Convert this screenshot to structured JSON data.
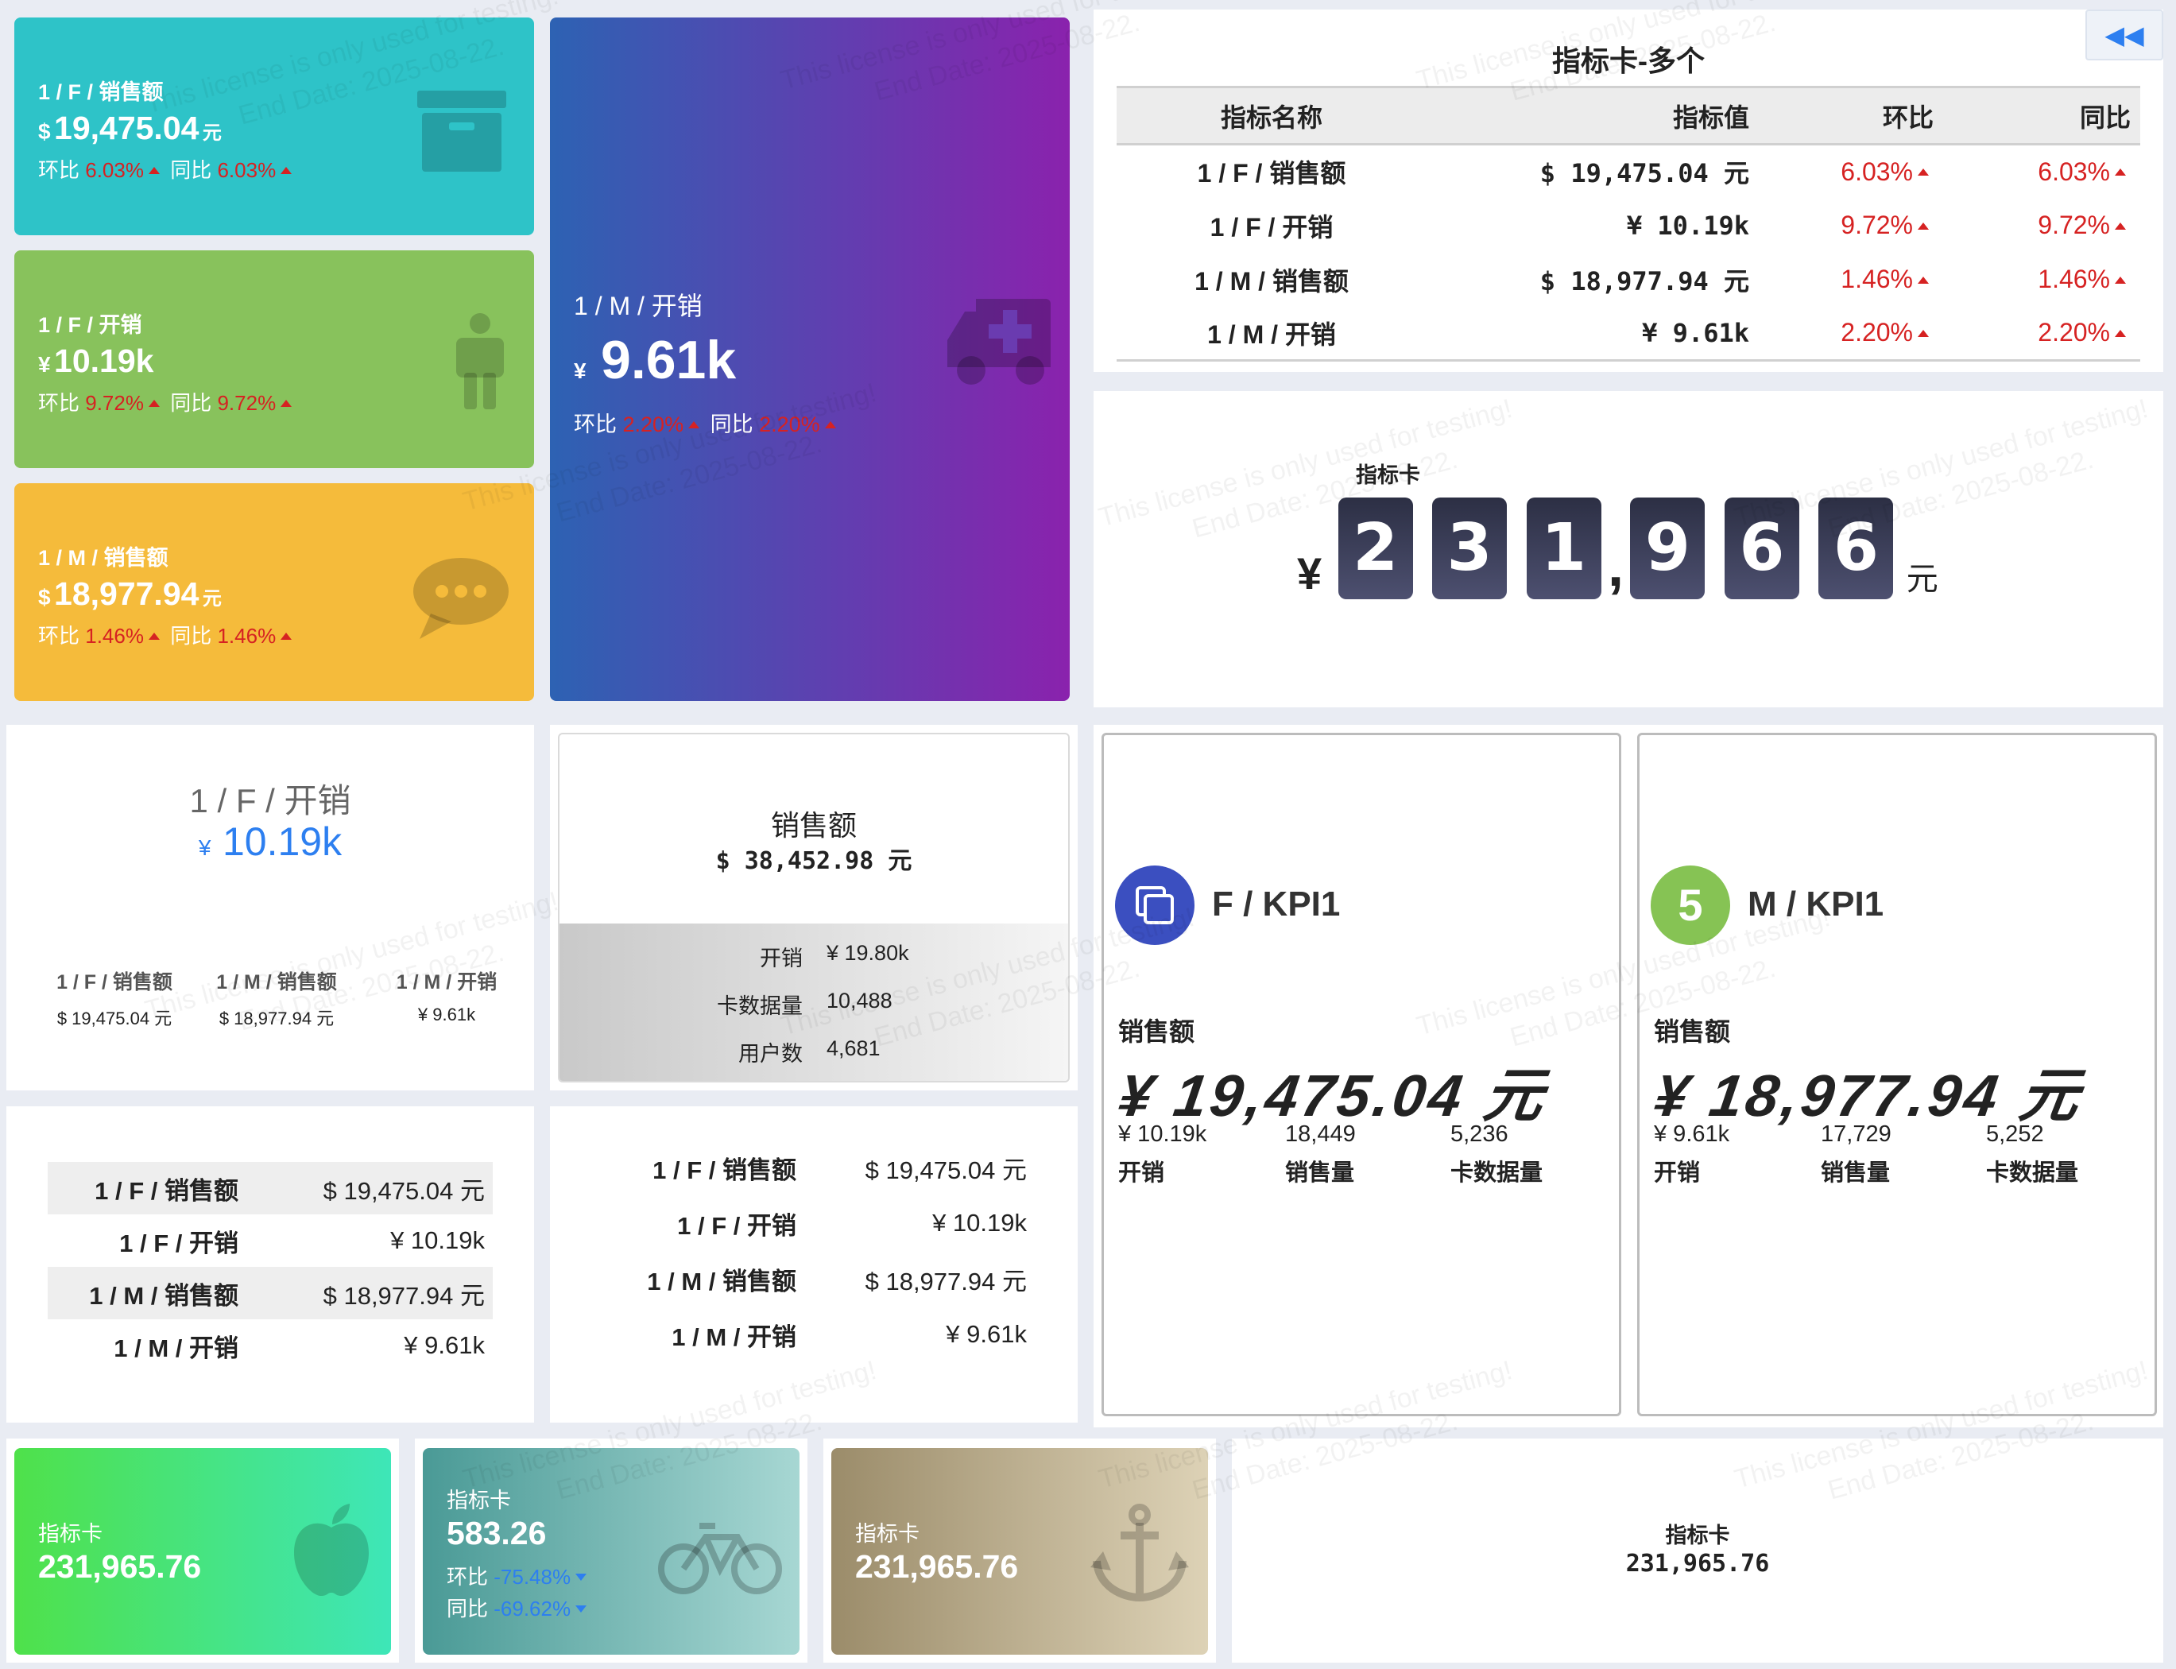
{
  "cards_top": [
    {
      "title": "1 / F / 销售额",
      "prefix": "$",
      "value": "19,475.04",
      "suffix": "元",
      "hb_label": "环比",
      "hb": "6.03%",
      "tb_label": "同比",
      "tb": "6.03%",
      "icon": "archive-box-icon"
    },
    {
      "title": "1 / F / 开销",
      "prefix": "¥",
      "value": "10.19k",
      "suffix": "",
      "hb_label": "环比",
      "hb": "9.72%",
      "tb_label": "同比",
      "tb": "9.72%",
      "icon": "person-icon"
    },
    {
      "title": "1 / M / 销售额",
      "prefix": "$",
      "value": "18,977.94",
      "suffix": "元",
      "hb_label": "环比",
      "hb": "1.46%",
      "tb_label": "同比",
      "tb": "1.46%",
      "icon": "chat-bubble-icon"
    }
  ],
  "big_card": {
    "title": "1 / M / 开销",
    "prefix": "¥",
    "value": "9.61k",
    "hb_label": "环比",
    "hb": "2.20%",
    "tb_label": "同比",
    "tb": "2.20%",
    "icon": "ambulance-icon"
  },
  "multi_table": {
    "title": "指标卡-多个",
    "headers": [
      "指标名称",
      "指标值",
      "环比",
      "同比"
    ],
    "rows": [
      {
        "name": "1 / F / 销售额",
        "value": "$ 19,475.04 元",
        "hb": "6.03%",
        "tb": "6.03%"
      },
      {
        "name": "1 / F / 开销",
        "value": "¥ 10.19k",
        "hb": "9.72%",
        "tb": "9.72%"
      },
      {
        "name": "1 / M / 销售额",
        "value": "$ 18,977.94 元",
        "hb": "1.46%",
        "tb": "1.46%"
      },
      {
        "name": "1 / M / 开销",
        "value": "¥ 9.61k",
        "hb": "2.20%",
        "tb": "2.20%"
      }
    ],
    "collapse_icon": "double-chevron-left-icon"
  },
  "flip_card": {
    "label": "指标卡",
    "currency": "¥",
    "digits": [
      "2",
      "3",
      "1",
      "9",
      "6",
      "6"
    ],
    "separator": ",",
    "unit": "元"
  },
  "center_card": {
    "title": "1 / F / 开销",
    "prefix": "¥",
    "value": "10.19k",
    "subs": [
      {
        "label": "1 / F / 销售额",
        "value": "$ 19,475.04 元"
      },
      {
        "label": "1 / M / 销售额",
        "value": "$ 18,977.94 元"
      },
      {
        "label": "1 / M / 开销",
        "value": "¥ 9.61k"
      }
    ]
  },
  "sales_card": {
    "title": "销售额",
    "value": "$ 38,452.98 元",
    "rows": [
      {
        "label": "开销",
        "value": "¥ 19.80k"
      },
      {
        "label": "卡数据量",
        "value": "10,488"
      },
      {
        "label": "用户数",
        "value": "4,681"
      }
    ]
  },
  "kpi_f": {
    "title": "F / KPI1",
    "icon": "copy-icon",
    "label": "销售额",
    "value": "¥ 19,475.04 元",
    "stats": [
      {
        "value": "¥ 10.19k",
        "label": "开销"
      },
      {
        "value": "18,449",
        "label": "销售量"
      },
      {
        "value": "5,236",
        "label": "卡数据量"
      }
    ]
  },
  "kpi_m": {
    "title": "M / KPI1",
    "icon": "number-five-icon",
    "label": "销售额",
    "value": "¥ 18,977.94 元",
    "stats": [
      {
        "value": "¥ 9.61k",
        "label": "开销"
      },
      {
        "value": "17,729",
        "label": "销售量"
      },
      {
        "value": "5,252",
        "label": "卡数据量"
      }
    ]
  },
  "striped_table": {
    "rows": [
      {
        "name": "1 / F / 销售额",
        "value": "$ 19,475.04 元"
      },
      {
        "name": "1 / F / 开销",
        "value": "¥  10.19k"
      },
      {
        "name": "1 / M / 销售额",
        "value": "$ 18,977.94 元"
      },
      {
        "name": "1 / M / 开销",
        "value": "¥  9.61k"
      }
    ]
  },
  "plain_table": {
    "rows": [
      {
        "name": "1 / F / 销售额",
        "value": "$ 19,475.04 元"
      },
      {
        "name": "1 / F / 开销",
        "value": "¥  10.19k"
      },
      {
        "name": "1 / M / 销售额",
        "value": "$ 18,977.94 元"
      },
      {
        "name": "1 / M / 开销",
        "value": "¥  9.61k"
      }
    ]
  },
  "bottom_cards": [
    {
      "label": "指标卡",
      "value": "231,965.76",
      "icon": "apple-icon"
    },
    {
      "label": "指标卡",
      "value": "583.26",
      "hb_label": "环比",
      "hb": "-75.48%",
      "tb_label": "同比",
      "tb": "-69.62%",
      "icon": "bicycle-icon"
    },
    {
      "label": "指标卡",
      "value": "231,965.76",
      "icon": "anchor-icon"
    },
    {
      "label": "指标卡",
      "value": "231,965.76"
    }
  ],
  "watermark": {
    "line1": "This license is only used for testing!",
    "line2": "End Date: 2025-08-22."
  }
}
